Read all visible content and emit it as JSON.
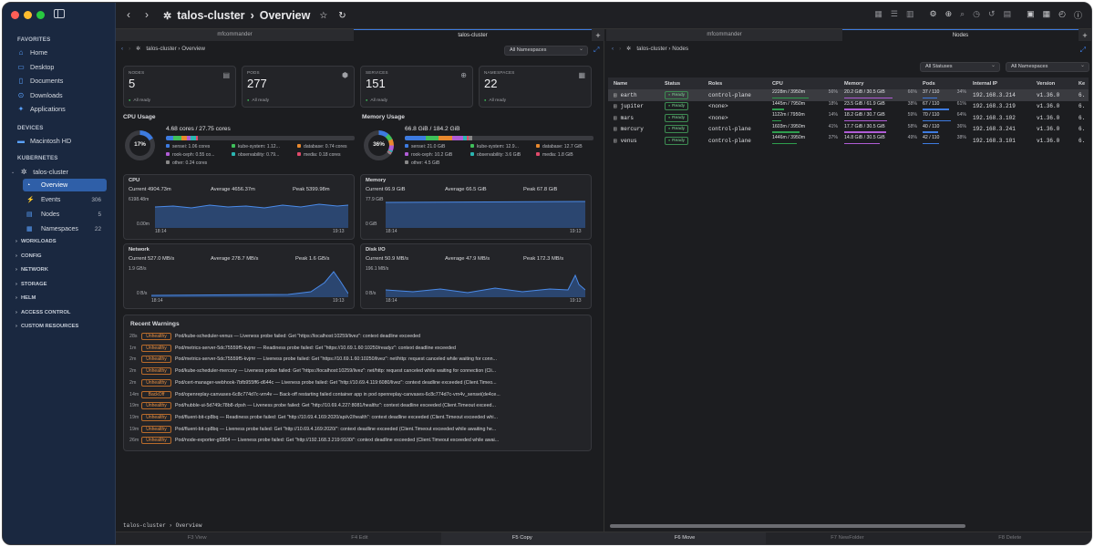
{
  "sidebar": {
    "favorites_label": "FAVORITES",
    "favorites": [
      {
        "label": "Home",
        "icon": "house-icon"
      },
      {
        "label": "Desktop",
        "icon": "desktop-icon"
      },
      {
        "label": "Documents",
        "icon": "document-icon"
      },
      {
        "label": "Downloads",
        "icon": "download-icon"
      },
      {
        "label": "Applications",
        "icon": "applications-icon"
      }
    ],
    "devices_label": "DEVICES",
    "devices": [
      {
        "label": "Macintosh HD",
        "icon": "disk-icon"
      }
    ],
    "kubernetes_label": "KUBERNETES",
    "cluster": "talos-cluster",
    "cluster_items": [
      {
        "label": "Overview",
        "count": "",
        "active": true
      },
      {
        "label": "Events",
        "count": "306"
      },
      {
        "label": "Nodes",
        "count": "5"
      },
      {
        "label": "Namespaces",
        "count": "22"
      }
    ],
    "groups": [
      "WORKLOADS",
      "CONFIG",
      "NETWORK",
      "STORAGE",
      "HELM",
      "ACCESS CONTROL",
      "CUSTOM RESOURCES"
    ]
  },
  "titlebar": {
    "title": "talos-cluster",
    "separator": "›",
    "page": "Overview"
  },
  "left_tabs": {
    "inactive": "mfcommander",
    "active": "talos-cluster",
    "add": "+"
  },
  "right_tabs": {
    "inactive": "mfcommander",
    "active": "Nodes",
    "add": "+"
  },
  "left": {
    "crumb_cluster": "talos-cluster",
    "crumb_sep": "›",
    "crumb_page": "Overview",
    "namespace_filter": "All Namespaces",
    "stats": [
      {
        "label": "NODES",
        "value": "5",
        "status": "All ready"
      },
      {
        "label": "PODS",
        "value": "277",
        "status": "All ready"
      },
      {
        "label": "SERVICES",
        "value": "151",
        "status": "All ready"
      },
      {
        "label": "NAMESPACES",
        "value": "22",
        "status": "All ready"
      }
    ],
    "cpu_usage": {
      "title": "CPU Usage",
      "percent": "17%",
      "headline": "4.68 cores / 27.75 cores",
      "legend": [
        "sensei: 1.06 cores",
        "kube-system: 1.12...",
        "database: 0.74 cores",
        "rook-ceph: 0.55 co...",
        "observability: 0.79...",
        "media: 0.18 cores",
        "other: 0.24 cores"
      ]
    },
    "memory_usage": {
      "title": "Memory Usage",
      "percent": "36%",
      "headline": "66.8 GiB / 184.2 GiB",
      "legend": [
        "sensei: 21.0 GiB",
        "kube-system: 12.9...",
        "database: 12.7 GiB",
        "rook-ceph: 10.2 GiB",
        "observability: 3.6 GiB",
        "media: 1.8 GiB",
        "other: 4.5 GiB"
      ]
    },
    "metrics": [
      {
        "title": "CPU",
        "current": "Current 4904.73m",
        "average": "Average 4656.37m",
        "peak": "Peak 5399.98m",
        "ymax": "6198.48m",
        "ymin": "0.00m",
        "t0": "18:14",
        "t1": "19:13"
      },
      {
        "title": "Memory",
        "current": "Current 66.9 GiB",
        "average": "Average 66.5 GiB",
        "peak": "Peak 67.8 GiB",
        "ymax": "77.9 GiB",
        "ymin": "0 GiB",
        "t0": "18:14",
        "t1": "19:13"
      },
      {
        "title": "Network",
        "current": "Current 527.0 MB/s",
        "average": "Average 278.7 MB/s",
        "peak": "Peak 1.6 GB/s",
        "ymax": "1.9 GB/s",
        "ymin": "0 B/s",
        "t0": "18:14",
        "t1": "19:13"
      },
      {
        "title": "Disk I/O",
        "current": "Current 50.9 MB/s",
        "average": "Average 47.9 MB/s",
        "peak": "Peak 172.3 MB/s",
        "ymax": "196.1 MB/s",
        "ymin": "0 B/s",
        "t0": "18:14",
        "t1": "19:13"
      }
    ],
    "warnings_title": "Recent Warnings",
    "warnings": [
      {
        "age": "28s",
        "type": "Unhealthy",
        "msg": "Pod/kube-scheduler-venus — Liveness probe failed: Get \"https://localhost:10259/livez\": context deadline exceeded"
      },
      {
        "age": "1m",
        "type": "Unhealthy",
        "msg": "Pod/metrics-server-5dc75559f5-kvjmr — Readiness probe failed: Get \"https://10.69.1.60:10250/readyz\": context deadline exceeded"
      },
      {
        "age": "2m",
        "type": "Unhealthy",
        "msg": "Pod/metrics-server-5dc75559f5-kvjmr — Liveness probe failed: Get \"https://10.69.1.60:10250/livez\": net/http: request canceled while waiting for conn..."
      },
      {
        "age": "2m",
        "type": "Unhealthy",
        "msg": "Pod/kube-scheduler-mercury — Liveness probe failed: Get \"https://localhost:10259/livez\": net/http: request canceled while waiting for connection (Cli..."
      },
      {
        "age": "2m",
        "type": "Unhealthy",
        "msg": "Pod/cert-manager-webhook-7bfb955ff6-d644c — Liveness probe failed: Get \"http://10.69.4.119:6080/livez\": context deadline exceeded (Client.Timeo..."
      },
      {
        "age": "14m",
        "type": "BackOff",
        "msg": "Pod/openreplay-canvases-6c8c774d7c-vrn4v — Back-off restarting failed container app in pod openreplay-canvases-6c8c774d7c-vrn4v_sensei(de4ce..."
      },
      {
        "age": "19m",
        "type": "Unhealthy",
        "msg": "Pod/hubble-ui-5d749c78b8-zlpsh — Liveness probe failed: Get \"http://10.69.4.227:8081/healthz\": context deadline exceeded (Client.Timeout exceed..."
      },
      {
        "age": "19m",
        "type": "Unhealthy",
        "msg": "Pod/fluent-bit-cp8bq — Readiness probe failed: Get \"http://10.69.4.169:2020/api/v2/health\": context deadline exceeded (Client.Timeout exceeded whi..."
      },
      {
        "age": "19m",
        "type": "Unhealthy",
        "msg": "Pod/fluent-bit-cp8bq — Liveness probe failed: Get \"http://10.69.4.169:2020/\": context deadline exceeded (Client.Timeout exceeded while awaiting he..."
      },
      {
        "age": "26m",
        "type": "Unhealthy",
        "msg": "Pod/node-exporter-g5854 — Liveness probe failed: Get \"http://192.168.3.219:9100/\": context deadline exceeded (Client.Timeout exceeded while awai..."
      }
    ],
    "statusline": "talos-cluster › Overview"
  },
  "right": {
    "crumb_cluster": "talos-cluster",
    "crumb_sep": "›",
    "crumb_page": "Nodes",
    "status_filter": "All Statuses",
    "namespace_filter": "All Namespaces",
    "columns": [
      "Name",
      "Status",
      "Roles",
      "CPU",
      "Memory",
      "Pods",
      "Internal IP",
      "Version",
      "Ke"
    ],
    "rows": [
      {
        "name": "earth",
        "status": "Ready",
        "roles": "control-plane",
        "cpu": "2228m / 3950m",
        "cpu_pct": "56%",
        "cpu_fill": 0.56,
        "mem": "20.2 GiB / 30.5 GiB",
        "mem_pct": "66%",
        "mem_fill": 0.66,
        "pods": "37 / 110",
        "pods_pct": "34%",
        "pods_fill": 0.34,
        "ip": "192.168.3.214",
        "version": "v1.36.0",
        "k": "6."
      },
      {
        "name": "jupiter",
        "status": "Ready",
        "roles": "<none>",
        "cpu": "1445m / 7950m",
        "cpu_pct": "18%",
        "cpu_fill": 0.18,
        "mem": "23.5 GiB / 61.9 GiB",
        "mem_pct": "38%",
        "mem_fill": 0.38,
        "pods": "67 / 110",
        "pods_pct": "61%",
        "pods_fill": 0.61,
        "ip": "192.168.3.219",
        "version": "v1.36.0",
        "k": "6."
      },
      {
        "name": "mars",
        "status": "Ready",
        "roles": "<none>",
        "cpu": "1122m / 7950m",
        "cpu_pct": "14%",
        "cpu_fill": 0.14,
        "mem": "18.2 GiB / 30.7 GiB",
        "mem_pct": "59%",
        "mem_fill": 0.59,
        "pods": "70 / 110",
        "pods_pct": "64%",
        "pods_fill": 0.64,
        "ip": "192.168.3.102",
        "version": "v1.36.0",
        "k": "6."
      },
      {
        "name": "mercury",
        "status": "Ready",
        "roles": "control-plane",
        "cpu": "1603m / 3950m",
        "cpu_pct": "41%",
        "cpu_fill": 0.41,
        "mem": "17.7 GiB / 30.5 GiB",
        "mem_pct": "58%",
        "mem_fill": 0.58,
        "pods": "40 / 110",
        "pods_pct": "36%",
        "pods_fill": 0.36,
        "ip": "192.168.3.241",
        "version": "v1.36.0",
        "k": "6."
      },
      {
        "name": "venus",
        "status": "Ready",
        "roles": "control-plane",
        "cpu": "1446m / 3950m",
        "cpu_pct": "37%",
        "cpu_fill": 0.37,
        "mem": "14.8 GiB / 30.5 GiB",
        "mem_pct": "49%",
        "mem_fill": 0.49,
        "pods": "42 / 110",
        "pods_pct": "38%",
        "pods_fill": 0.38,
        "ip": "192.168.3.101",
        "version": "v1.36.0",
        "k": "6."
      }
    ]
  },
  "fkeys": [
    "F3 View",
    "F4 Edit",
    "F5 Copy",
    "F6 Move",
    "F7 NewFolder",
    "F8 Delete"
  ],
  "colors": {
    "accent": "#3d7be0",
    "ready": "#3fbf5a",
    "warning": "#e89044",
    "sidebar_bg": "#1a2840"
  }
}
